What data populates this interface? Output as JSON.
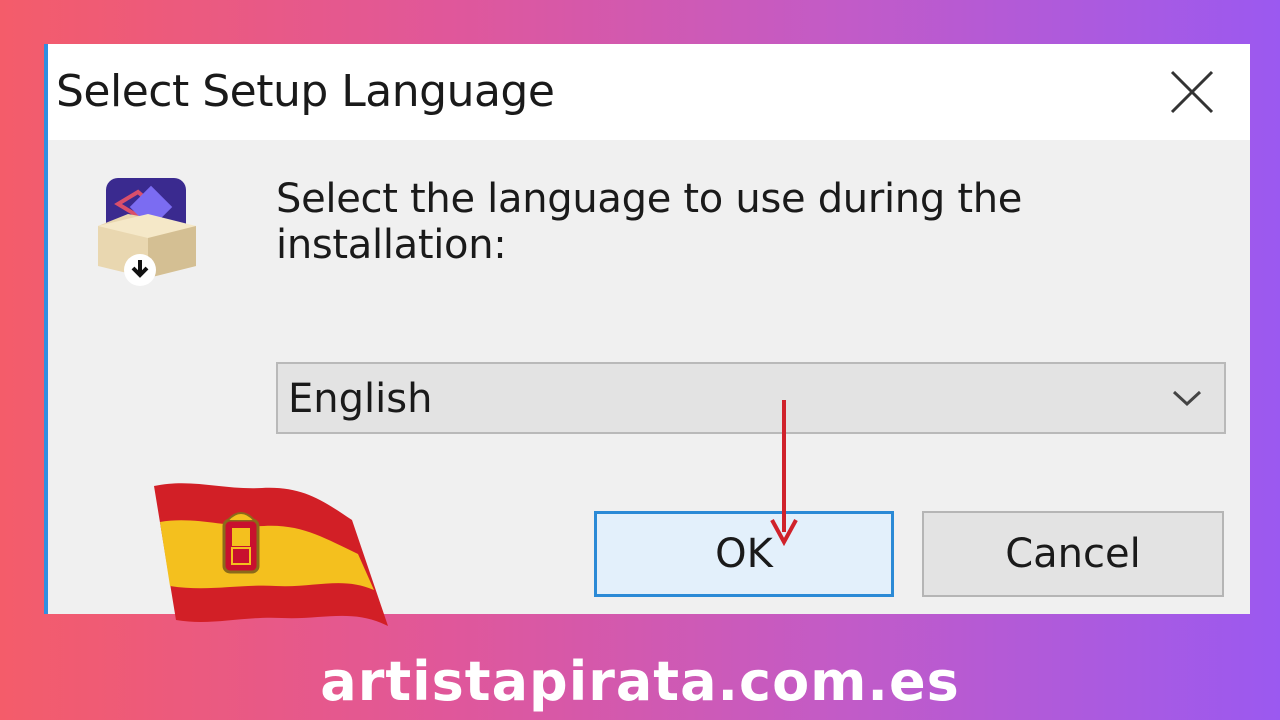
{
  "dialog": {
    "title": "Select Setup Language",
    "prompt": "Select the language to use during the installation:",
    "language_select": {
      "selected": "English"
    },
    "buttons": {
      "ok": "OK",
      "cancel": "Cancel"
    },
    "icons": {
      "close": "close-icon",
      "app": "installer-box-icon",
      "dropdown": "chevron-down-icon"
    }
  },
  "overlay": {
    "flag": "spain-flag",
    "arrow_color": "#d0222b"
  },
  "footer": {
    "site": "artistapirata.com.es"
  },
  "colors": {
    "accent": "#2f8fe0",
    "ok_border": "#2b8ad6",
    "ok_fill": "#e3f0fb"
  }
}
